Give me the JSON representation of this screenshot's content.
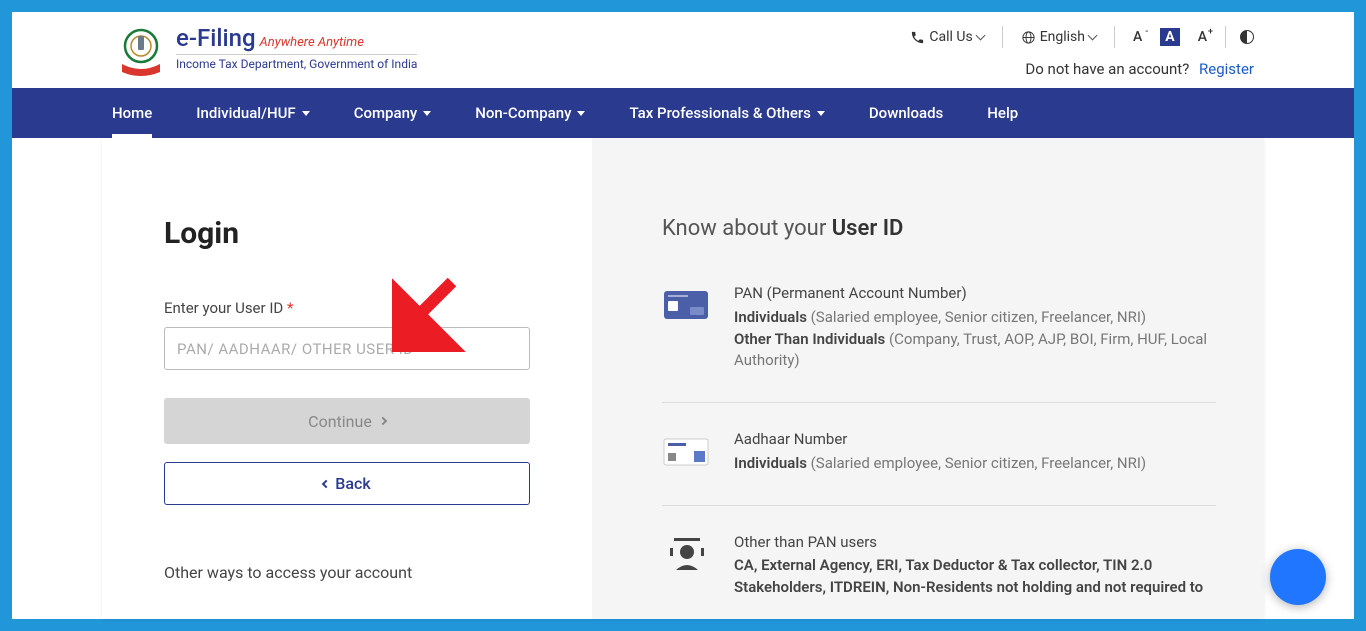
{
  "header": {
    "logo_main": "e-Filing",
    "logo_tag": "Anywhere Anytime",
    "logo_sub": "Income Tax Department, Government of India",
    "call_us": "Call Us",
    "language": "English",
    "no_account": "Do not have an account?",
    "register": "Register"
  },
  "nav": {
    "home": "Home",
    "individual": "Individual/HUF",
    "company": "Company",
    "noncompany": "Non-Company",
    "taxpro": "Tax Professionals & Others",
    "downloads": "Downloads",
    "help": "Help"
  },
  "login": {
    "title": "Login",
    "label": "Enter your User ID",
    "required": "*",
    "placeholder": "PAN/ AADHAAR/ OTHER USER ID",
    "continue": "Continue",
    "back": "Back",
    "other_ways": "Other ways to access your account"
  },
  "info": {
    "title_prefix": "Know about your ",
    "title_strong": "User ID",
    "pan": {
      "heading": "PAN (Permanent Account Number)",
      "individuals_label": "Individuals",
      "individuals_text": " (Salaried employee, Senior citizen, Freelancer, NRI)",
      "other_label": "Other Than Individuals",
      "other_text": " (Company, Trust, AOP, AJP, BOI, Firm, HUF, Local Authority)"
    },
    "aadhaar": {
      "heading": "Aadhaar Number",
      "individuals_label": "Individuals",
      "individuals_text": " (Salaried employee, Senior citizen, Freelancer, NRI)"
    },
    "other": {
      "heading": "Other than PAN users",
      "line1a": "CA, External Agency, ERI, Tax Deductor & Tax collector, TIN 2.0 Stakeholders, ITDREIN, ",
      "line1b": "Non-Residents not holding and not required to"
    }
  }
}
